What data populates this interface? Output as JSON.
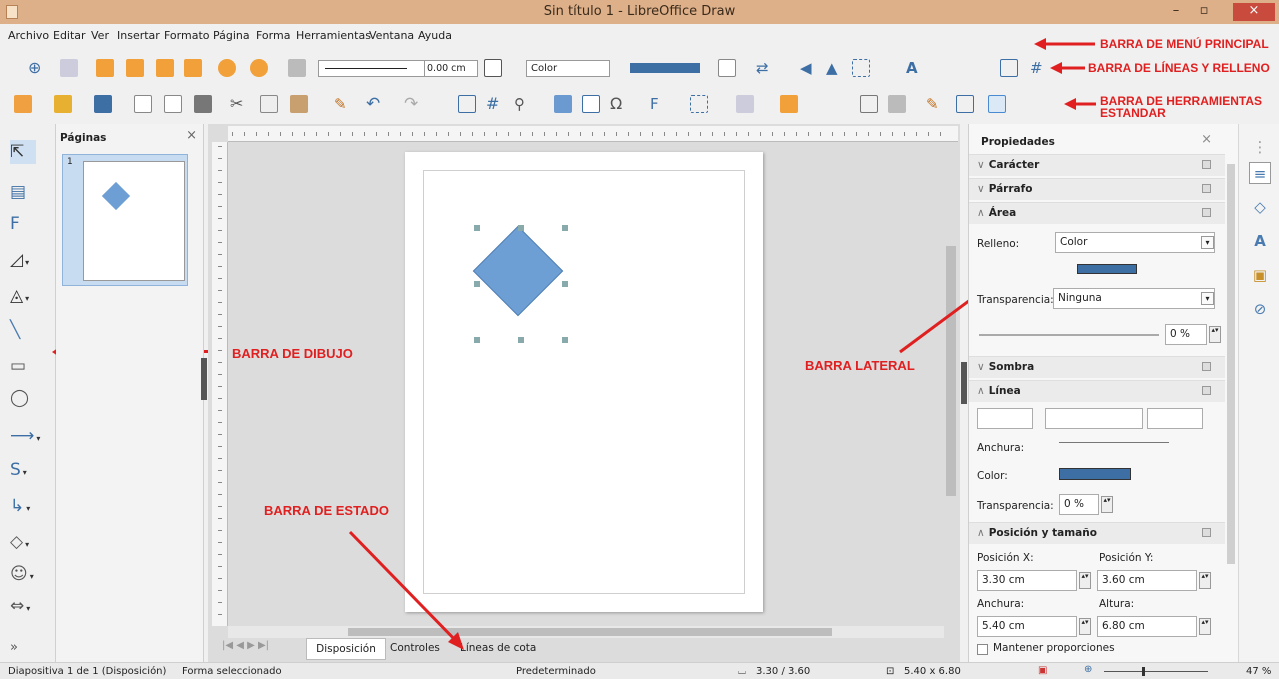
{
  "window": {
    "title": "Sin título 1 - LibreOffice Draw",
    "minimize": "–",
    "maximize": "▫",
    "close": "×"
  },
  "menu": [
    "Archivo",
    "Editar",
    "Ver",
    "Insertar",
    "Formato",
    "Página",
    "Forma",
    "Herramientas",
    "Ventana",
    "Ayuda"
  ],
  "line_toolbar": {
    "line_width": "0.00 cm",
    "fill_type": "Color"
  },
  "annotations": {
    "menu": "BARRA DE MENÚ PRINCIPAL",
    "lines": "BARRA DE LÍNEAS Y RELLENO",
    "standard1": "BARRA DE HERRAMIENTAS",
    "standard2": "ESTANDAR",
    "drawing": "BARRA DE DIBUJO",
    "sidebar": "BARRA LATERAL",
    "status": "BARRA DE ESTADO"
  },
  "pages_pane": {
    "title": "Páginas",
    "close": "×",
    "page_number": "1"
  },
  "tabs": [
    "Disposición",
    "Controles",
    "Líneas de cota"
  ],
  "properties": {
    "title": "Propiedades",
    "sections": {
      "character": "Carácter",
      "paragraph": "Párrafo",
      "area": "Área",
      "shadow": "Sombra",
      "line": "Línea",
      "position": "Posición y tamaño"
    },
    "area": {
      "fill_label": "Relleno:",
      "fill_value": "Color",
      "transparency_label": "Transparencia:",
      "transparency_value": "Ninguna",
      "transparency_pct": "0 %"
    },
    "line": {
      "width_label": "Anchura:",
      "color_label": "Color:",
      "transparency_label": "Transparencia:",
      "transparency_value": "0 %"
    },
    "position": {
      "pos_x_label": "Posición X:",
      "pos_y_label": "Posición Y:",
      "pos_x": "3.30 cm",
      "pos_y": "3.60 cm",
      "width_label": "Anchura:",
      "height_label": "Altura:",
      "width": "5.40 cm",
      "height": "6.80 cm",
      "keep_ratio": "Mantener proporciones"
    }
  },
  "status": {
    "slide": "Diapositiva 1 de 1 (Disposición)",
    "selection": "Forma seleccionado",
    "master": "Predeterminado",
    "position": "3.30 / 3.60",
    "size": "5.40 x 6.80",
    "zoom": "47 %"
  },
  "colors": {
    "shape": "#6e9fd4",
    "accent": "#e02020",
    "titlebar": "#ddb08a"
  }
}
